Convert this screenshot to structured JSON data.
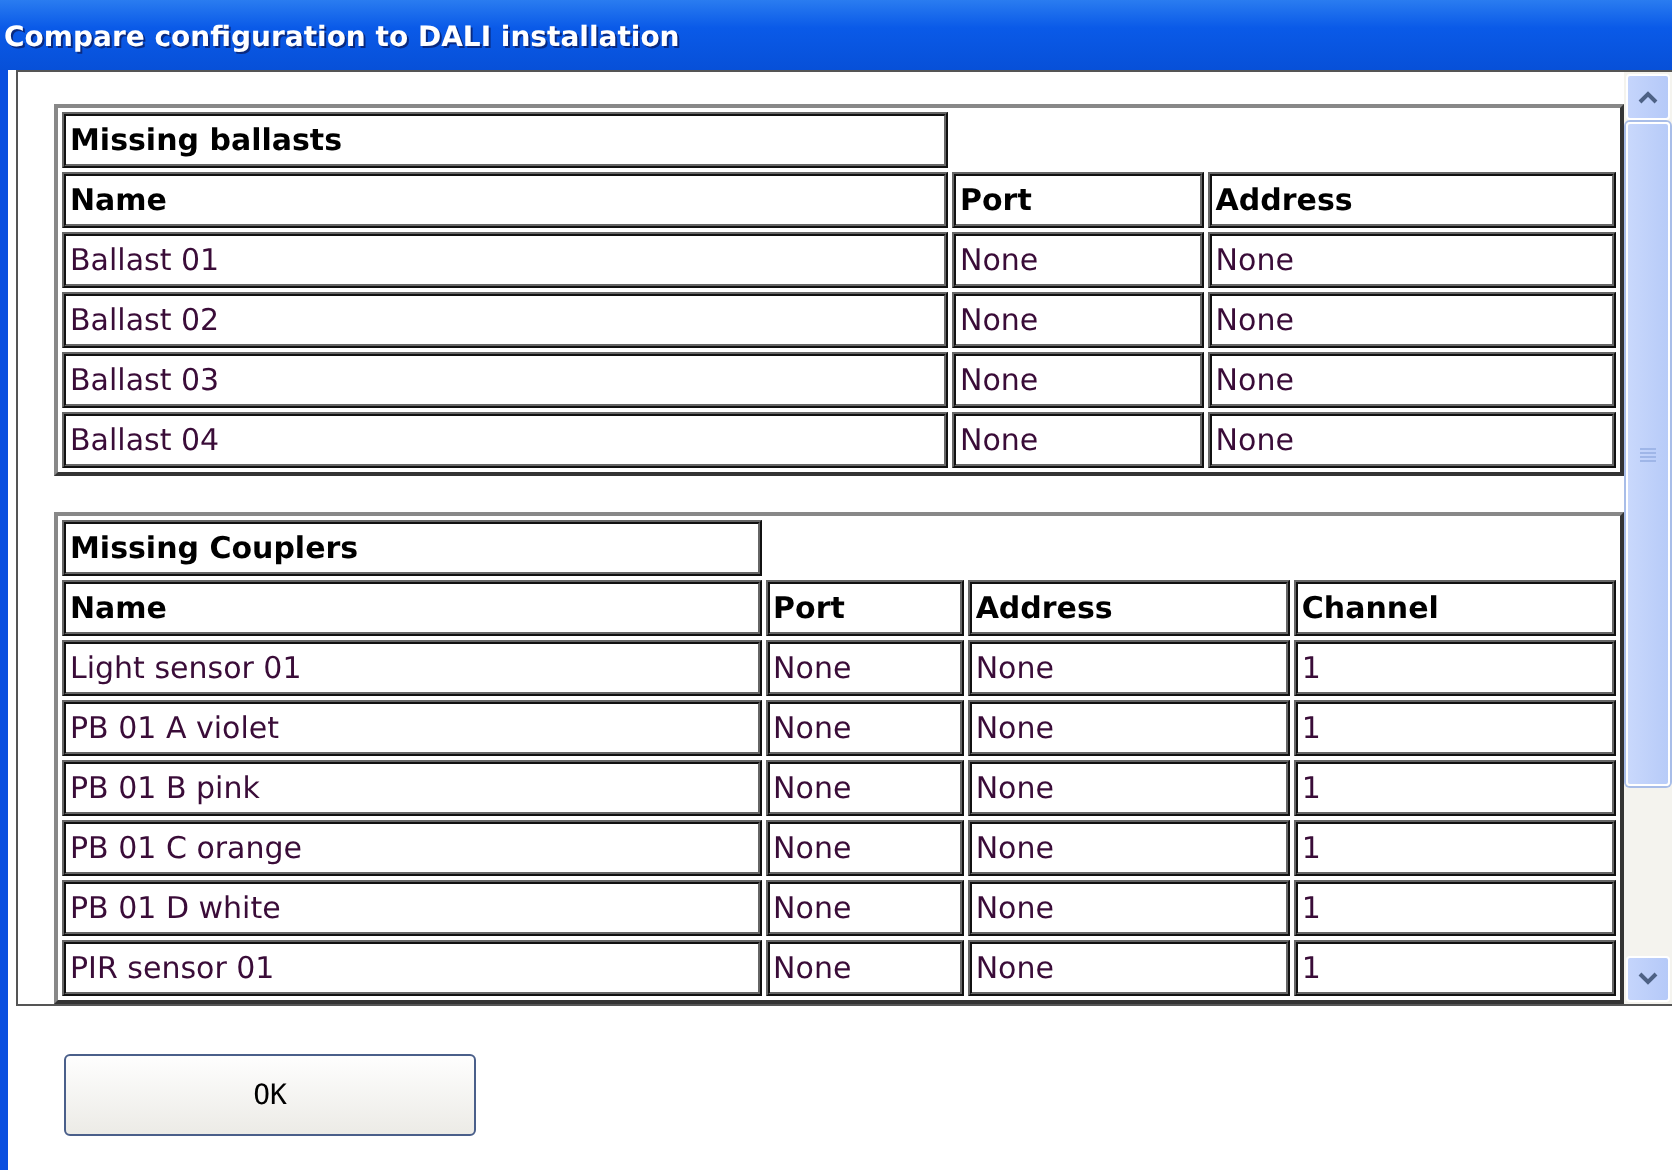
{
  "window": {
    "title": "Compare configuration to DALI installation"
  },
  "tables": [
    {
      "title": "Missing ballasts",
      "columns": [
        "Name",
        "Port",
        "Address"
      ],
      "rows": [
        [
          "Ballast 01",
          "None",
          "None"
        ],
        [
          "Ballast 02",
          "None",
          "None"
        ],
        [
          "Ballast 03",
          "None",
          "None"
        ],
        [
          "Ballast 04",
          "None",
          "None"
        ]
      ]
    },
    {
      "title": "Missing Couplers",
      "columns": [
        "Name",
        "Port",
        "Address",
        "Channel"
      ],
      "rows": [
        [
          "Light sensor 01",
          "None",
          "None",
          "1"
        ],
        [
          "PB 01 A violet",
          "None",
          "None",
          "1"
        ],
        [
          "PB 01 B pink",
          "None",
          "None",
          "1"
        ],
        [
          "PB 01 C orange",
          "None",
          "None",
          "1"
        ],
        [
          "PB 01 D white",
          "None",
          "None",
          "1"
        ],
        [
          "PIR sensor 01",
          "None",
          "None",
          "1"
        ]
      ]
    }
  ],
  "buttons": [
    "OK"
  ]
}
